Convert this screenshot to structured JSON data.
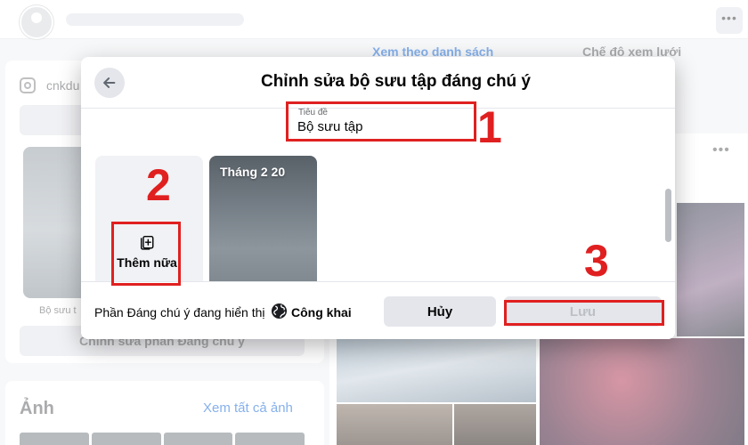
{
  "background": {
    "instagram_handle": "cnkdu",
    "view_tabs": [
      "Xem theo danh sách",
      "Chế độ xem lưới"
    ],
    "story_caption": "Bộ sưu t",
    "edit_button_label": "Chỉnh sửa phần Đáng chú ý",
    "photos_title": "Ảnh",
    "photos_link": "Xem tất cả ảnh",
    "more_icon": "more-dots-icon"
  },
  "modal": {
    "title": "Chỉnh sửa bộ sưu tập đáng chú ý",
    "back_icon": "arrow-left-icon",
    "title_field": {
      "label": "Tiêu đề",
      "value": "Bộ sưu tập"
    },
    "add_more": {
      "label": "Thêm nữa",
      "icon": "add-story-icon"
    },
    "story_tile": {
      "date": "Tháng 2 20"
    },
    "footer": {
      "privacy_text": "Phần Đáng chú ý đang hiển thị",
      "privacy_icon": "globe-icon",
      "privacy_value": "Công khai",
      "cancel_label": "Hủy",
      "save_label": "Lưu"
    }
  },
  "annotations": {
    "step1": "1",
    "step2": "2",
    "step3": "3",
    "color": "#e02020"
  }
}
